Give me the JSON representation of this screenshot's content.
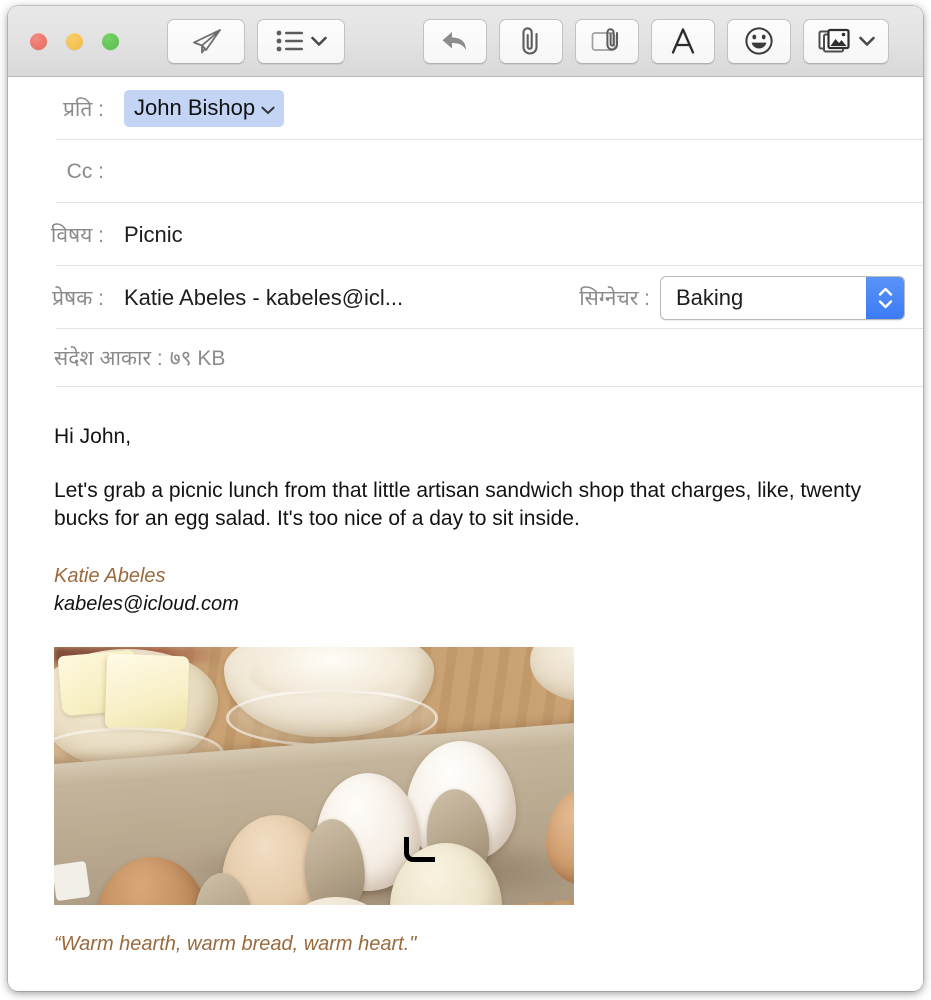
{
  "window": {
    "traffic_lights": [
      {
        "name": "close",
        "color": "#EC6A5E"
      },
      {
        "name": "minimize",
        "color": "#F4BF4F"
      },
      {
        "name": "maximize",
        "color": "#61C554"
      }
    ]
  },
  "toolbar": {
    "buttons": [
      {
        "name": "send-button",
        "icon": "paper-plane-icon",
        "label": ""
      },
      {
        "name": "stationery-list-button",
        "icon": "bulleted-list-icon",
        "label": "",
        "has_chevron": true
      },
      {
        "name": "reply-button",
        "icon": "reply-arrow-icon",
        "label": ""
      },
      {
        "name": "attach-button",
        "icon": "paperclip-icon",
        "label": ""
      },
      {
        "name": "attach-document-button",
        "icon": "document-paperclip-icon",
        "label": ""
      },
      {
        "name": "format-button",
        "icon": "letter-a-icon",
        "label": ""
      },
      {
        "name": "emoji-button",
        "icon": "smiley-face-icon",
        "label": ""
      },
      {
        "name": "photo-browser-button",
        "icon": "photos-icon",
        "label": "",
        "has_chevron": true
      }
    ]
  },
  "headers": {
    "to": {
      "label": "प्रति :",
      "token": "John Bishop",
      "token_bg": "#C3D4F5"
    },
    "cc": {
      "label": "Cc :",
      "value": ""
    },
    "subject": {
      "label": "विषय :",
      "value": "Picnic"
    },
    "from": {
      "label": "प्रेषक :",
      "value": "Katie Abeles - kabeles@icl..."
    },
    "signature": {
      "label": "सिग्नेचर :",
      "selected": "Baking",
      "stepper_color": "#4A86F7"
    },
    "message_size": {
      "label": "संदेश आकार :",
      "value": "७९ KB"
    }
  },
  "body": {
    "greeting": "Hi John,",
    "paragraph": "Let's grab a picnic lunch from that little artisan sandwich shop that charges, like, twenty bucks for an egg salad. It's too nice of a day to sit inside.",
    "signature_name": "Katie Abeles",
    "signature_email": "kabeles@icloud.com",
    "signature_name_color": "#9A6A3C",
    "photo_alt": "Eggs in a carton beside bowls of butter and flour on a wooden table",
    "quote": "“Warm hearth, warm bread, warm heart.\""
  }
}
